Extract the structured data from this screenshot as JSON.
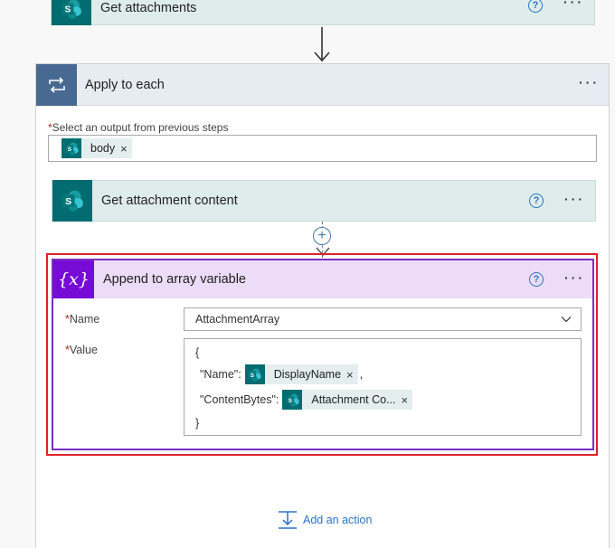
{
  "top_card": {
    "title": "Get attachments",
    "help": "?",
    "more": "···"
  },
  "apply_each": {
    "title": "Apply to each",
    "more": "···",
    "select_required": "*",
    "select_label": "Select an output from previous steps",
    "token": {
      "label": "body",
      "remove": "×"
    }
  },
  "get_attachment_content": {
    "title": "Get attachment content",
    "help": "?",
    "more": "···"
  },
  "plus": "+",
  "append": {
    "title": "Append to array variable",
    "icon_text": "{x}",
    "help": "?",
    "more": "···",
    "name_required": "*",
    "name_label": "Name",
    "name_value": "AttachmentArray",
    "value_required": "*",
    "value_label": "Value",
    "value_open": "{",
    "value_name_key": "\"Name\":",
    "value_name_token": "DisplayName",
    "value_name_comma": ",",
    "value_bytes_key": "\"ContentBytes\":",
    "value_bytes_token": "Attachment Co...",
    "value_close": "}",
    "token_remove": "×"
  },
  "add_action": {
    "label": "Add an action"
  },
  "colors": {
    "sharepoint": "#036c70",
    "sp_card_bg": "#deeceb",
    "loop_tile": "#486991",
    "variable_tile": "#770bd6",
    "highlight_red": "#e0202a",
    "link_blue": "#2b73c6"
  },
  "icons": {
    "sharepoint": "sharepoint-logo-icon",
    "loop": "loop-icon",
    "variable": "variable-icon",
    "help": "help-circle-icon",
    "more": "more-dots-icon",
    "chevron": "chevron-down-icon",
    "add_action": "add-action-icon"
  }
}
